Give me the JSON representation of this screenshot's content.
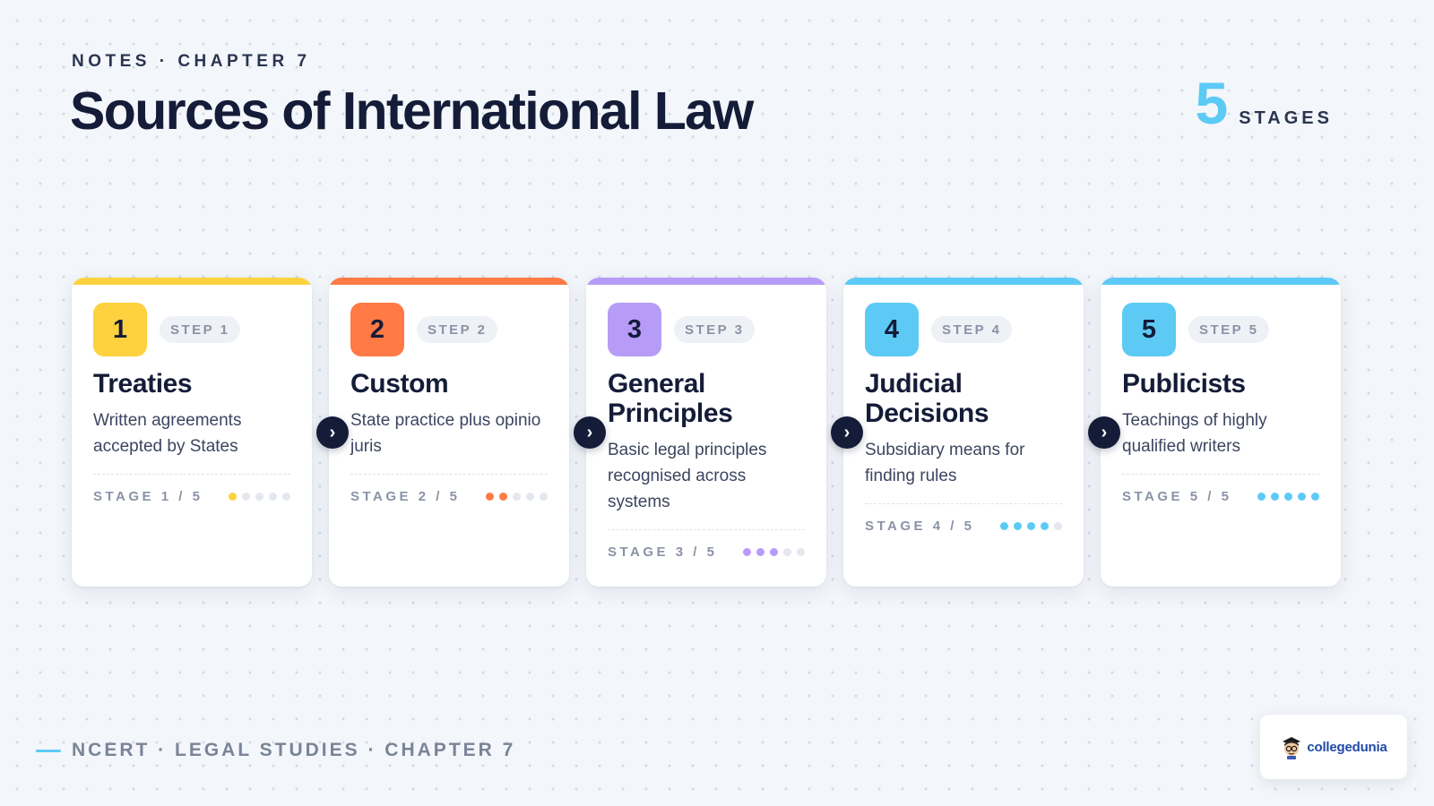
{
  "header": {
    "eyebrow": "NOTES · CHAPTER 7",
    "title": "Sources of International Law",
    "stage_total": "5",
    "stage_total_label": "STAGES"
  },
  "steps": [
    {
      "number": "1",
      "step_label": "STEP 1",
      "title": "Treaties",
      "description": "Written agreements accepted by States",
      "stage_label": "STAGE 1 / 5",
      "progress": 1,
      "color": "#fdd23e"
    },
    {
      "number": "2",
      "step_label": "STEP 2",
      "title": "Custom",
      "description": "State practice plus opinio juris",
      "stage_label": "STAGE 2 / 5",
      "progress": 2,
      "color": "#ff7a45"
    },
    {
      "number": "3",
      "step_label": "STEP 3",
      "title": "General Principles",
      "description": "Basic legal principles recognised across systems",
      "stage_label": "STAGE 3 / 5",
      "progress": 3,
      "color": "#b79cf7"
    },
    {
      "number": "4",
      "step_label": "STEP 4",
      "title": "Judicial Decisions",
      "description": "Subsidiary means for finding rules",
      "stage_label": "STAGE 4 / 5",
      "progress": 4,
      "color": "#5ccaf5"
    },
    {
      "number": "5",
      "step_label": "STEP 5",
      "title": "Publicists",
      "description": "Teachings of highly qualified writers",
      "stage_label": "STAGE 5 / 5",
      "progress": 5,
      "color": "#5ccaf5"
    }
  ],
  "footer": {
    "text": "NCERT · LEGAL STUDIES · CHAPTER 7"
  },
  "logo": {
    "brand": "collegedunia"
  },
  "colors": {
    "navy": "#141c38",
    "accent": "#5ccaf5",
    "dot_inactive": "#e3e7ee"
  }
}
